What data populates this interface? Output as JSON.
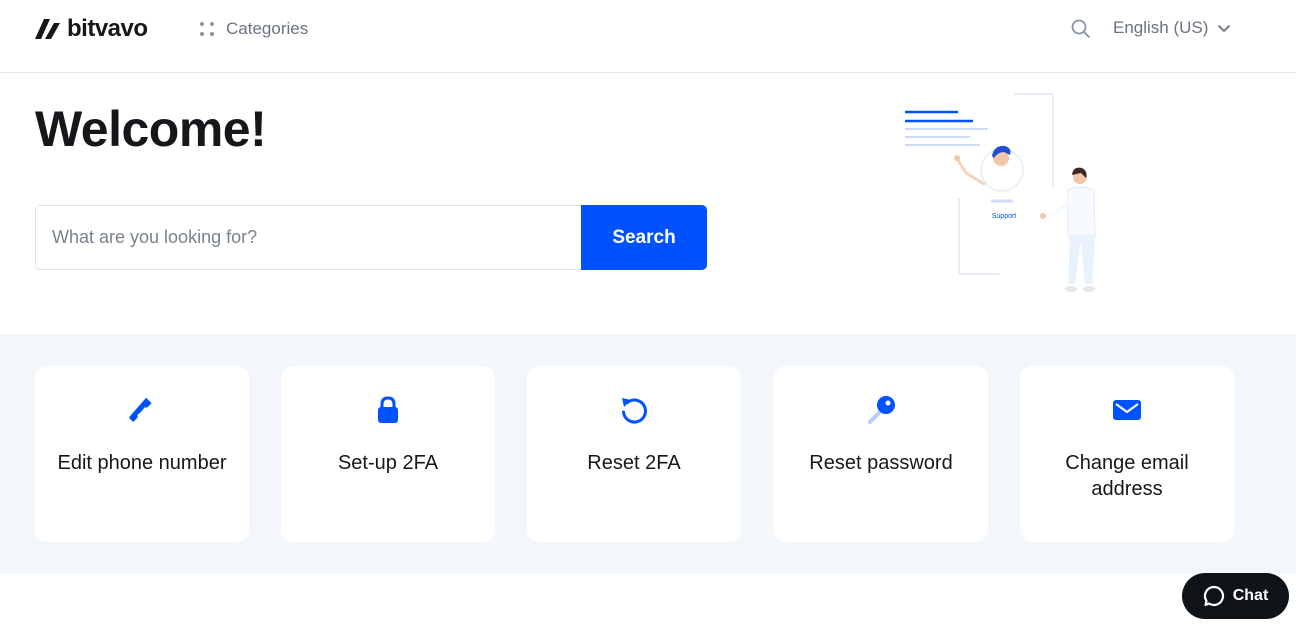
{
  "header": {
    "logo_text": "bitvavo",
    "categories_label": "Categories",
    "language_label": "English (US)"
  },
  "hero": {
    "title": "Welcome!",
    "search_placeholder": "What are you looking for?",
    "search_button_label": "Search",
    "illustration_label": "Support"
  },
  "cards": [
    {
      "label": "Edit phone number",
      "icon": "phone-icon"
    },
    {
      "label": "Set-up 2FA",
      "icon": "lock-icon"
    },
    {
      "label": "Reset 2FA",
      "icon": "reset-icon"
    },
    {
      "label": "Reset password",
      "icon": "key-icon"
    },
    {
      "label": "Change email address",
      "icon": "mail-icon"
    }
  ],
  "chat": {
    "label": "Chat"
  },
  "colors": {
    "accent": "#0052ff",
    "text": "#16171a",
    "muted": "#6b7280",
    "band": "#f3f7fb",
    "chat_bg": "#0f1419"
  }
}
